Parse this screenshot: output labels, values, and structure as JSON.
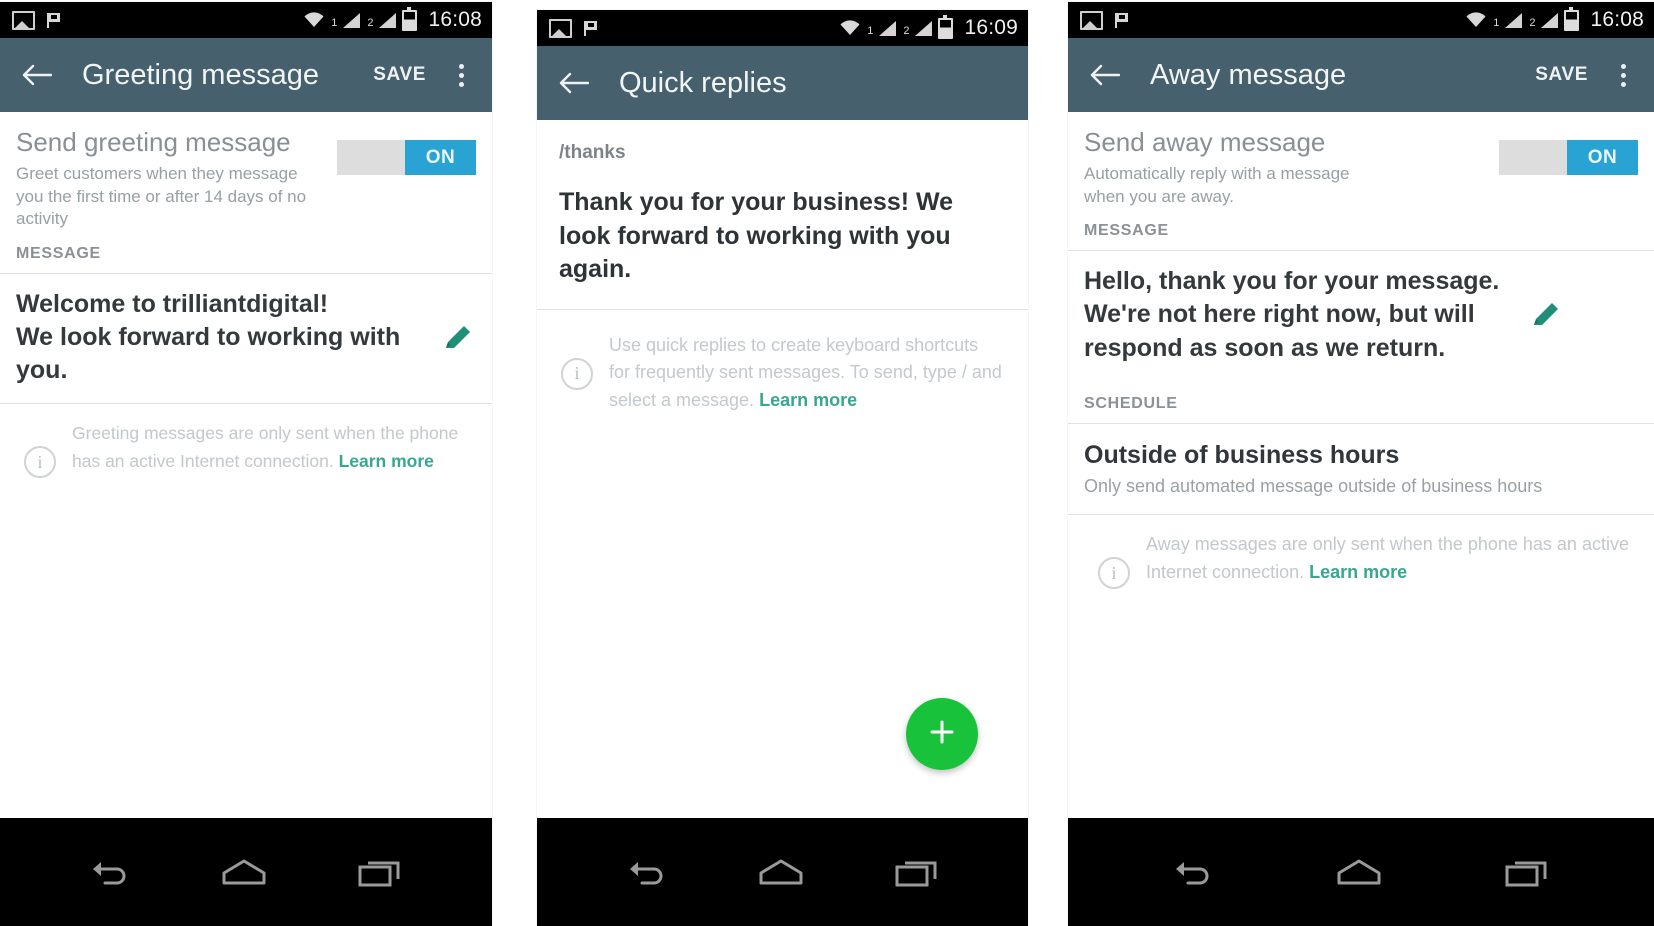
{
  "colors": {
    "appbar": "#47606e",
    "statusbar": "#000000",
    "accent_blue": "#29a3d4",
    "accent_green": "#18c33b",
    "link_teal": "#37a88f",
    "pencil_teal": "#1f8f77"
  },
  "icons": {
    "image_icon": "image-icon",
    "flag_icon": "flag-icon",
    "wifi_icon": "wifi-icon",
    "signal_icon": "signal-bars-icon",
    "battery_icon": "battery-icon",
    "back_icon": "back-arrow-icon",
    "more_icon": "overflow-menu-icon",
    "pencil_icon": "edit-pencil-icon",
    "info_icon": "info-icon",
    "plus_icon": "plus-icon",
    "nav_back_icon": "nav-back-icon",
    "nav_home_icon": "nav-home-icon",
    "nav_recents_icon": "nav-recents-icon"
  },
  "panels": [
    {
      "statusbar": {
        "sim1": "1",
        "sim2": "2",
        "clock": "16:08"
      },
      "appbar": {
        "title": "Greeting message",
        "save_label": "SAVE"
      },
      "toggle": {
        "title": "Send greeting message",
        "subtitle": "Greet customers when they message you the first time or after 14 days of no activity",
        "state_label": "ON"
      },
      "section_label": "MESSAGE",
      "message": "Welcome to trilliantdigital!\nWe look forward to working with you.",
      "info": {
        "text": "Greeting messages are only sent when the phone has an active Internet connection. ",
        "link": "Learn more"
      }
    },
    {
      "statusbar": {
        "sim1": "1",
        "sim2": "2",
        "clock": "16:09"
      },
      "appbar": {
        "title": "Quick replies"
      },
      "shortcut": "/thanks",
      "body": "Thank you for your business! We look forward to working with you again.",
      "info": {
        "text": "Use quick replies to create keyboard shortcuts for frequently sent messages. To send, type / and select a message. ",
        "link": "Learn more"
      },
      "fab_label": "+"
    },
    {
      "statusbar": {
        "sim1": "1",
        "sim2": "2",
        "clock": "16:08"
      },
      "appbar": {
        "title": "Away message",
        "save_label": "SAVE"
      },
      "toggle": {
        "title": "Send away message",
        "subtitle": "Automatically reply with a message when you are away.",
        "state_label": "ON"
      },
      "section_label": "MESSAGE",
      "message": "Hello, thank you for your message. We're not here right now, but will respond as soon as we return.",
      "schedule_label": "SCHEDULE",
      "schedule": {
        "title": "Outside of business hours",
        "subtitle": "Only send automated message outside of business hours"
      },
      "info": {
        "text": "Away messages are only sent when the phone has an active Internet connection. ",
        "link": "Learn more"
      }
    }
  ]
}
